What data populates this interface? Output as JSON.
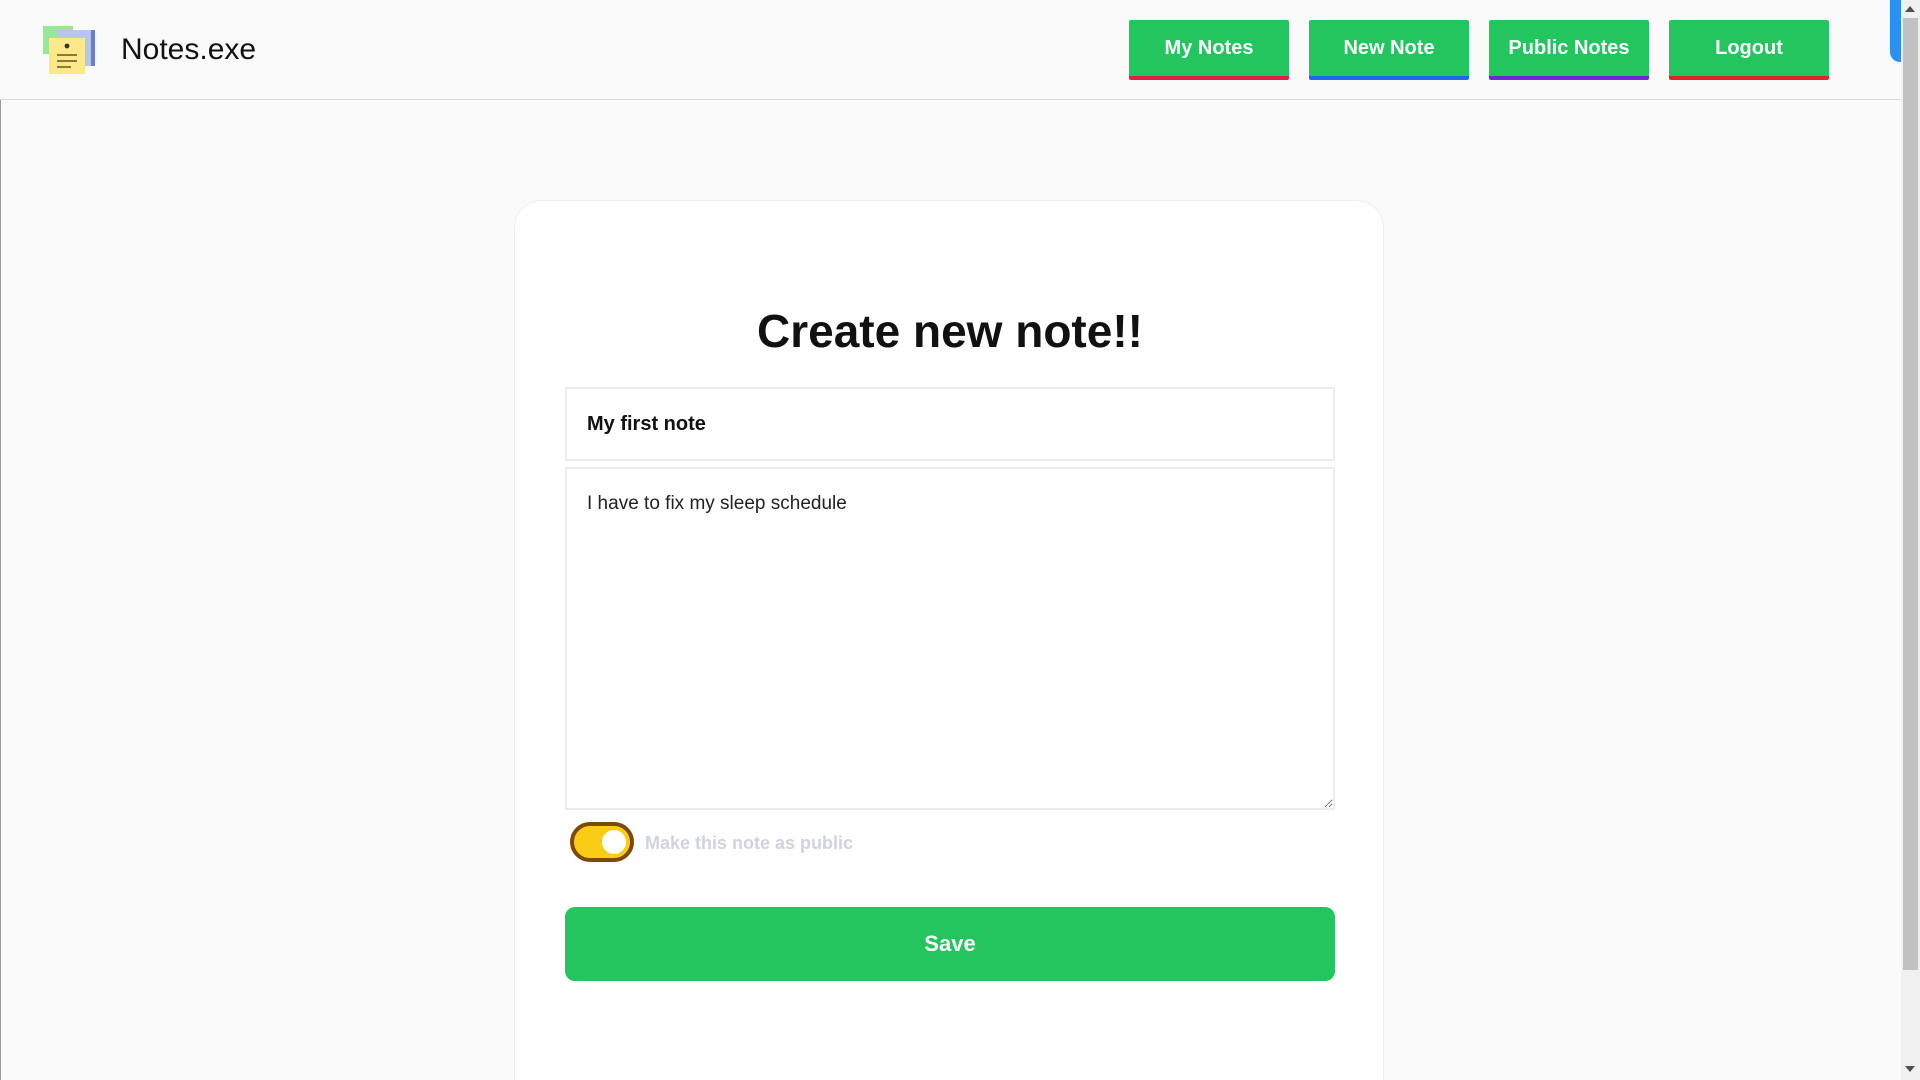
{
  "app": {
    "title": "Notes.exe",
    "logo_icon": "sticky-notes-icon"
  },
  "nav": {
    "items": [
      {
        "label": "My Notes",
        "underline_color": "#e11d48"
      },
      {
        "label": "New Note",
        "underline_color": "#2563eb"
      },
      {
        "label": "Public Notes",
        "underline_color": "#6d28d9"
      },
      {
        "label": "Logout",
        "underline_color": "#dc2626"
      }
    ],
    "button_color": "#22c55e"
  },
  "form": {
    "heading": "Create new note!!",
    "title_value": "My first note",
    "body_value": "I have to fix my sleep schedule",
    "public_toggle": {
      "label": "Make this note as public",
      "checked": true
    },
    "save_label": "Save"
  },
  "colors": {
    "accent_green": "#22c55e",
    "toggle_on": "#facc15",
    "toggle_border": "#7c4a03"
  }
}
